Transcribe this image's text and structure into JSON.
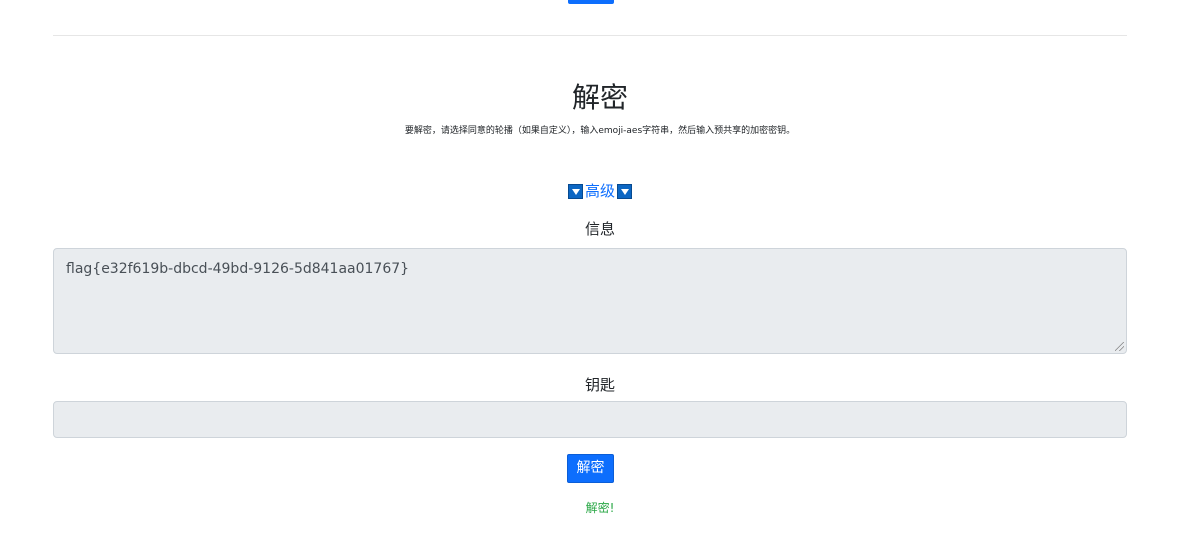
{
  "colors": {
    "accent": "#0d6efd",
    "input_bg": "#e9ecef",
    "success": "#28a745",
    "divider": "#e6e6e6"
  },
  "decrypt_section": {
    "title": "解密",
    "description": "要解密，请选择同意的轮播（如果自定义），输入emoji-aes字符串，然后输入预共享的加密密钥。",
    "advanced_label": "高级",
    "message_label": "信息",
    "message_value": "flag{e32f619b-dbcd-49bd-9126-5d841aa01767}",
    "key_label": "钥匙",
    "key_value": "",
    "decrypt_button_label": "解密",
    "status_text": "解密!"
  },
  "icons": {
    "advanced_left": "triangle-down-icon",
    "advanced_right": "triangle-down-icon"
  }
}
